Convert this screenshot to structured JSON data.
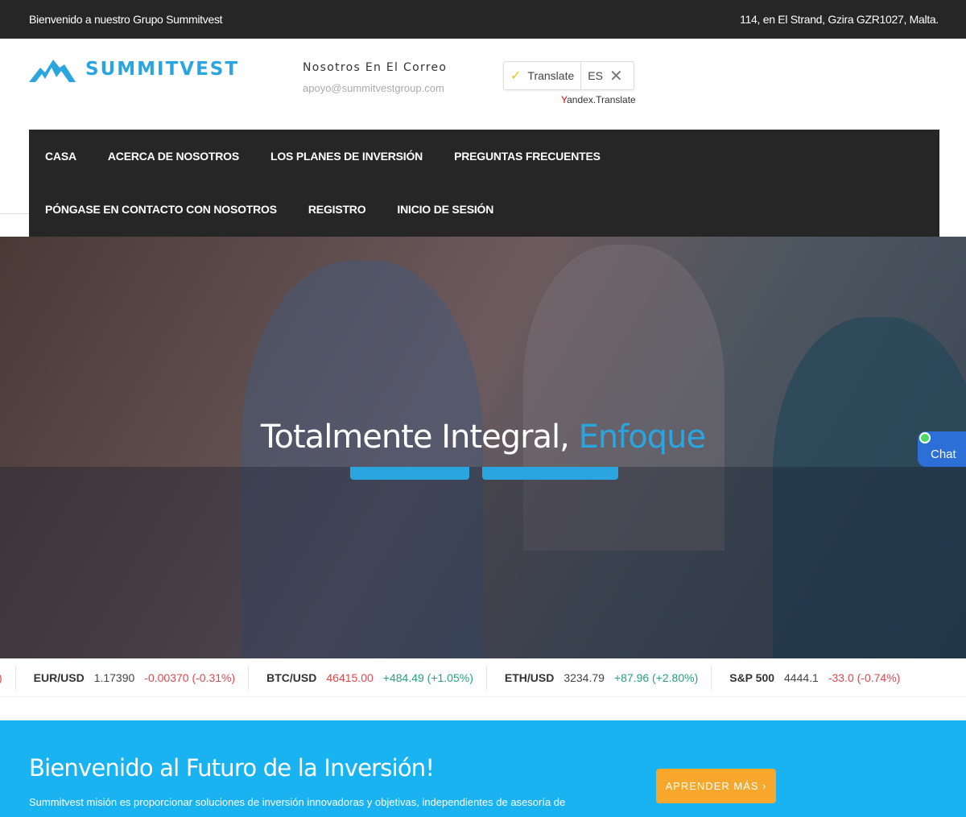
{
  "topbar": {
    "welcome": "Bienvenido a nuestro Grupo Summitvest",
    "address": "114, en El Strand, Gzira GZR1027, Malta."
  },
  "header": {
    "logo": "SUMMITVEST",
    "contact_title": "Nosotros En El Correo",
    "email": "apoyo@summitvestgroup.com",
    "translate_label": "Translate",
    "lang": "ES",
    "yandex_y": "Y",
    "yandex_rest": "andex.Translate"
  },
  "nav": {
    "row1": [
      "CASA",
      "ACERCA DE NOSOTROS",
      "LOS PLANES DE INVERSIÓN",
      "PREGUNTAS FRECUENTES"
    ],
    "row2": [
      "PÓNGASE EN CONTACTO CON NOSOTROS",
      "REGISTRO",
      "INICIO DE SESIÓN"
    ]
  },
  "hero": {
    "title_main": "Totalmente Integral, ",
    "title_accent": "Enfoque"
  },
  "chat": {
    "label": "Chat"
  },
  "ticker": [
    {
      "symbol": "EUR/USD",
      "price": "1.17390",
      "change": "-0.00370 (-0.31%)",
      "dir": "neg"
    },
    {
      "symbol": "BTC/USD",
      "price": "46415.00",
      "change": "+484.49 (+1.05%)",
      "dir": "pos"
    },
    {
      "symbol": "ETH/USD",
      "price": "3234.79",
      "change": "+87.96 (+2.80%)",
      "dir": "pos"
    },
    {
      "symbol": "S&P 500",
      "price": "4444.1",
      "change": "-33.0 (-0.74%)",
      "dir": "neg"
    }
  ],
  "ticker_prev_tail": ")",
  "cta": {
    "title": "Bienvenido al Futuro de la Inversión!",
    "text": "Summitvest misión es proporcionar soluciones de inversión innovadoras y objetivas, independientes de asesoría de",
    "button": "APRENDER MÁS ›"
  },
  "colors": {
    "accent": "#2ba5e0",
    "cta_bg": "#1ab3f2",
    "button": "#f7a82c",
    "dark": "#262626"
  }
}
